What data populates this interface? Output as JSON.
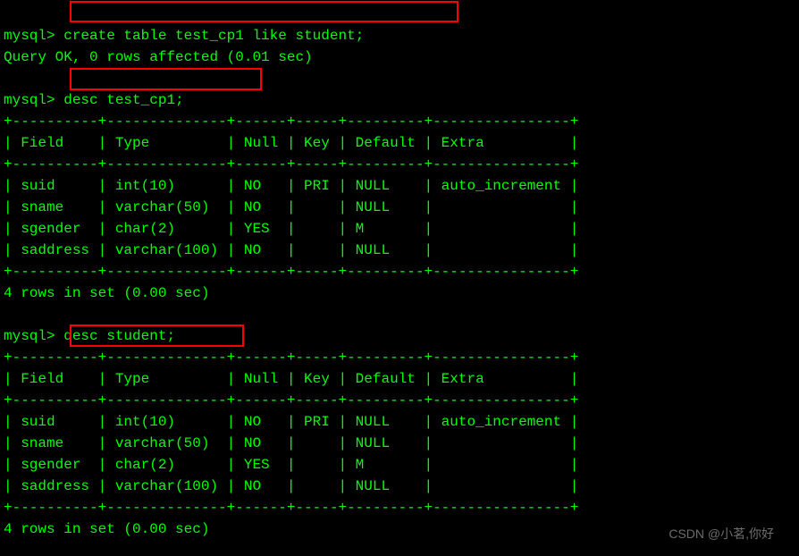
{
  "prompt": "mysql>",
  "cmd1": "create table test_cp1 like student;",
  "result1": "Query OK, 0 rows affected (0.01 sec)",
  "cmd2": "desc test_cp1;",
  "cmd3": "desc student;",
  "table_border_top": "+----------+--------------+------+-----+---------+----------------+",
  "table_header": "| Field    | Type         | Null | Key | Default | Extra          |",
  "table_rows": [
    "| suid     | int(10)      | NO   | PRI | NULL    | auto_increment |",
    "| sname    | varchar(50)  | NO   |     | NULL    |                |",
    "| sgender  | char(2)      | YES  |     | M       |                |",
    "| saddress | varchar(100) | NO   |     | NULL    |                |"
  ],
  "rows_summary": "4 rows in set (0.00 sec)",
  "watermark": "CSDN @小茗,你好",
  "table_data": {
    "columns": [
      "Field",
      "Type",
      "Null",
      "Key",
      "Default",
      "Extra"
    ],
    "rows": [
      {
        "Field": "suid",
        "Type": "int(10)",
        "Null": "NO",
        "Key": "PRI",
        "Default": "NULL",
        "Extra": "auto_increment"
      },
      {
        "Field": "sname",
        "Type": "varchar(50)",
        "Null": "NO",
        "Key": "",
        "Default": "NULL",
        "Extra": ""
      },
      {
        "Field": "sgender",
        "Type": "char(2)",
        "Null": "YES",
        "Key": "",
        "Default": "M",
        "Extra": ""
      },
      {
        "Field": "saddress",
        "Type": "varchar(100)",
        "Null": "NO",
        "Key": "",
        "Default": "NULL",
        "Extra": ""
      }
    ]
  }
}
